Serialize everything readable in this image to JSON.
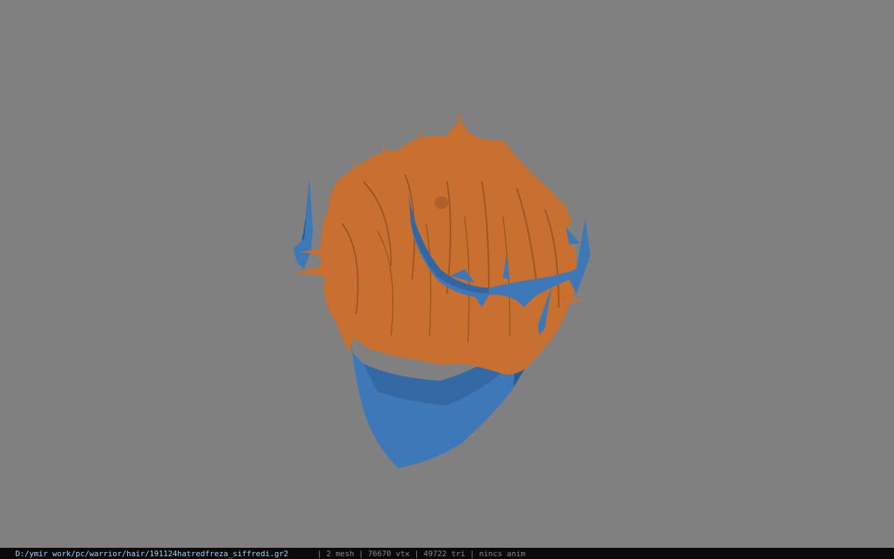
{
  "viewport": {
    "background_color": "#808080",
    "hair_color": "#c8702f",
    "hair_shadow_color": "#9d5421",
    "mask_color": "#3d79b8",
    "mask_shadow_color": "#2b5c94"
  },
  "status_bar": {
    "file_path": "D:/ymir work/pc/warrior/hair/191124hatredfreza_siffredi.gr2",
    "separator": "|",
    "mesh_count": "2 mesh",
    "vertex_count": "76670 vtx",
    "triangle_count": "49722 tri",
    "anim_status": "nincs anim",
    "path_color": "#9fd7ff",
    "text_color": "#8a8a8a",
    "background_color": "#0a0a0a"
  }
}
